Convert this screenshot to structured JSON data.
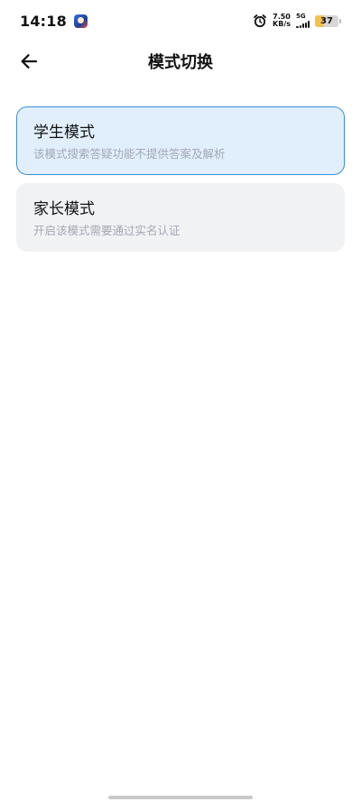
{
  "status_bar": {
    "time": "14:18",
    "net_speed_value": "7.50",
    "net_speed_unit": "KB/s",
    "network_type": "5G",
    "battery_level": "37",
    "battery_fraction": 0.37,
    "icons": [
      "app-notification-icon",
      "alarm-icon",
      "signal-icon",
      "battery-icon"
    ]
  },
  "header": {
    "title": "模式切换",
    "back_icon": "arrow-left-icon"
  },
  "modes": [
    {
      "name": "学生模式",
      "description": "该模式搜索答疑功能不提供答案及解析",
      "selected": true
    },
    {
      "name": "家长模式",
      "description": "开启该模式需要通过实名认证",
      "selected": false
    }
  ],
  "colors": {
    "selected_bg": "#e1effc",
    "selected_border": "#3a8fd6",
    "normal_bg": "#f1f2f4",
    "desc_text": "#a3a8b3"
  }
}
